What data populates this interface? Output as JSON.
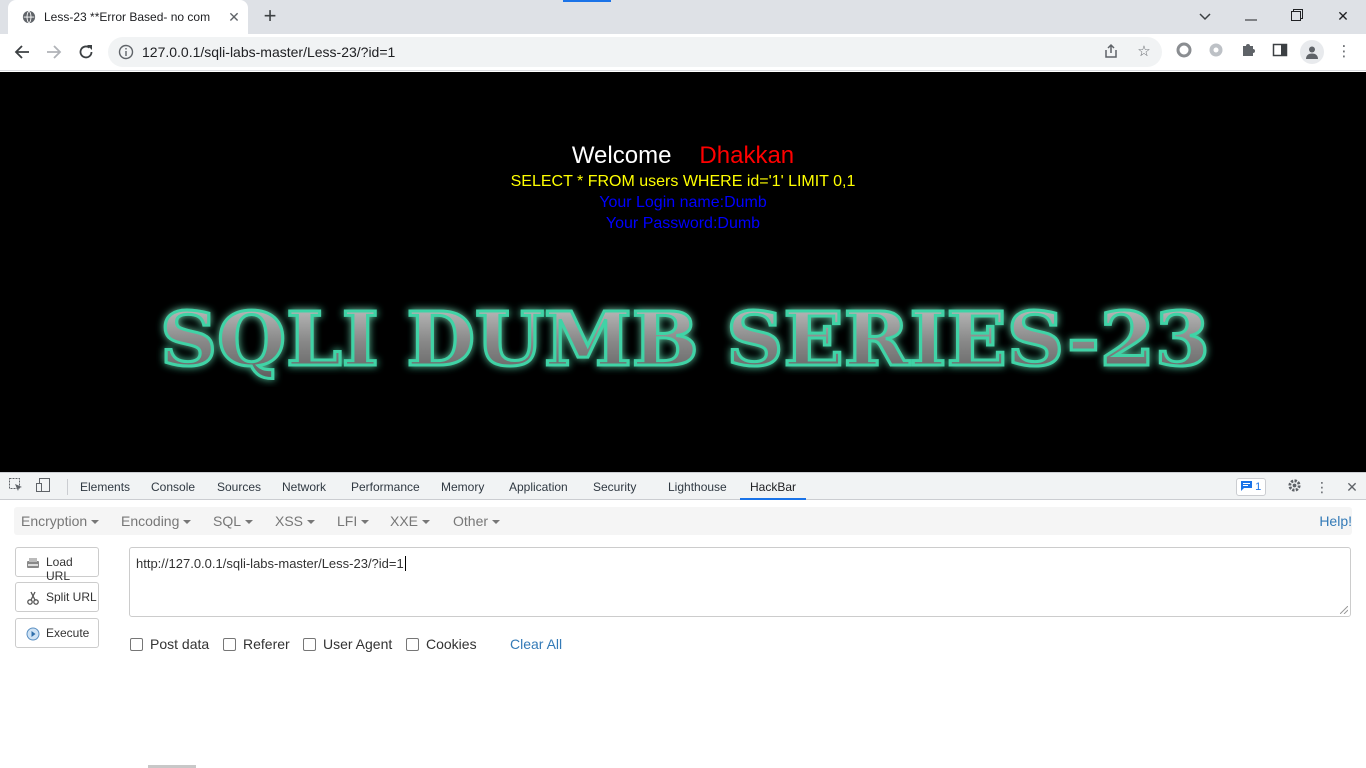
{
  "browser": {
    "tab_title": "Less-23 **Error Based- no com",
    "url": "127.0.0.1/sqli-labs-master/Less-23/?id=1"
  },
  "page": {
    "welcome": "Welcome",
    "name": "Dhakkan",
    "query": "SELECT * FROM users WHERE id='1' LIMIT 0,1",
    "login": "Your Login name:Dumb",
    "password": "Your Password:Dumb",
    "banner": "SQLI DUMB SERIES-23"
  },
  "devtools": {
    "tabs": [
      "Elements",
      "Console",
      "Sources",
      "Network",
      "Performance",
      "Memory",
      "Application",
      "Security",
      "Lighthouse",
      "HackBar"
    ],
    "active_tab": "HackBar",
    "issues_count": "1"
  },
  "hackbar": {
    "menus": [
      "Encryption",
      "Encoding",
      "SQL",
      "XSS",
      "LFI",
      "XXE",
      "Other"
    ],
    "help": "Help!",
    "load_url": "Load URL",
    "split_url": "Split URL",
    "execute": "Execute",
    "url_value": "http://127.0.0.1/sqli-labs-master/Less-23/?id=1",
    "checks": [
      "Post data",
      "Referer",
      "User Agent",
      "Cookies"
    ],
    "clear_all": "Clear All"
  },
  "colors": {
    "accent": "#1a73e8",
    "page_bg": "#000000",
    "query": "#ffff00",
    "login": "#0000ff",
    "name": "#ff0000",
    "link": "#337ab7"
  }
}
